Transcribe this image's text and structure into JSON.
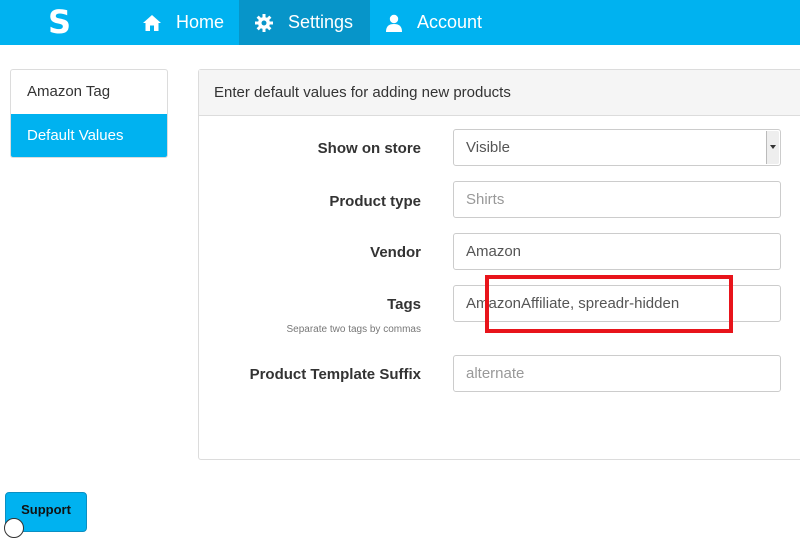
{
  "nav": {
    "logo": "S",
    "items": [
      {
        "label": "Home",
        "icon": "home-icon"
      },
      {
        "label": "Settings",
        "icon": "gear-icon",
        "active": true
      },
      {
        "label": "Account",
        "icon": "user-icon"
      }
    ]
  },
  "sidebar": {
    "items": [
      {
        "label": "Amazon Tag"
      },
      {
        "label": "Default Values",
        "active": true
      }
    ]
  },
  "panel": {
    "title": "Enter default values for adding new products",
    "fields": {
      "show_on_store": {
        "label": "Show on store",
        "value": "Visible"
      },
      "product_type": {
        "label": "Product type",
        "placeholder": "Shirts"
      },
      "vendor": {
        "label": "Vendor",
        "value": "Amazon"
      },
      "tags": {
        "label": "Tags",
        "hint": "Separate two tags by commas",
        "value": "AmazonAffiliate, spreadr-hidden"
      },
      "template_suffix": {
        "label": "Product Template Suffix",
        "placeholder": "alternate"
      }
    }
  },
  "support": {
    "label": "Support"
  },
  "colors": {
    "accent": "#00b2f0",
    "accent_dark": "#0795c9",
    "highlight": "#e8141b"
  }
}
